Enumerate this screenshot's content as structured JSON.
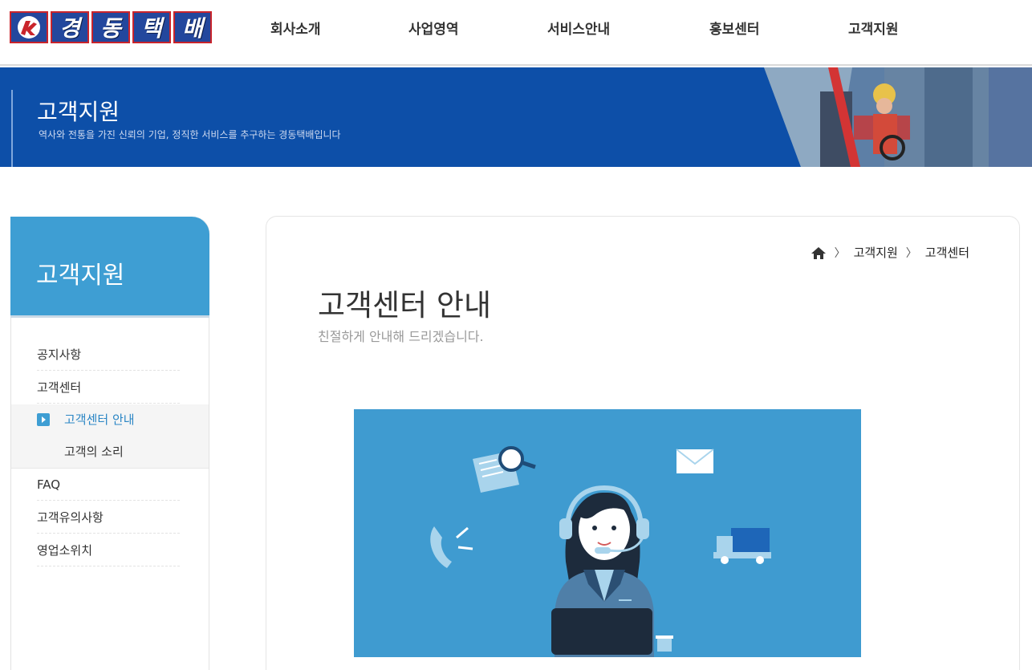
{
  "header": {
    "logo_text": "경동택배",
    "logo_chars": [
      "경",
      "동",
      "택",
      "배"
    ],
    "nav": [
      "회사소개",
      "사업영역",
      "서비스안내",
      "홍보센터",
      "고객지원"
    ]
  },
  "banner": {
    "title": "고객지원",
    "subtitle": "역사와 전통을 가진 신뢰의 기업, 정직한 서비스를 추구하는 경동택배입니다"
  },
  "sidebar": {
    "title": "고객지원",
    "items": [
      "공지사항",
      "고객센터",
      "FAQ",
      "고객유의사항",
      "영업소위치"
    ],
    "sub_items": [
      "고객센터 안내",
      "고객의 소리"
    ],
    "active_sub": "고객센터 안내"
  },
  "breadcrumb": {
    "items": [
      "고객지원",
      "고객센터"
    ],
    "separator": "〉"
  },
  "main": {
    "title": "고객센터 안내",
    "subtitle": "친절하게 안내해 드리겠습니다."
  },
  "colors": {
    "banner_bg": "#0d4fa8",
    "sidebar_head": "#3e9ed3",
    "illustration_bg": "#3f9bd0",
    "active_link": "#2b86c5"
  },
  "icons": [
    "home-icon",
    "play-icon",
    "phone-icon",
    "document-search-icon",
    "mail-icon",
    "truck-icon",
    "headset-icon"
  ]
}
